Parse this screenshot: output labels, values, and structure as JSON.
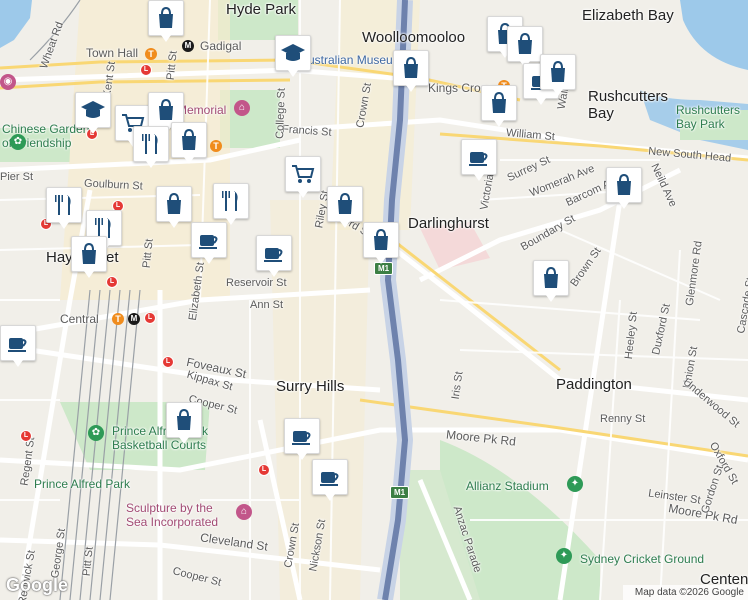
{
  "map": {
    "labels": {
      "hyde_park": "Hyde Park",
      "elizabeth_bay": "Elizabeth Bay",
      "woolloomooloo": "Woolloomooloo",
      "gadigal": "Gadigal",
      "town_hall": "Town Hall",
      "australian_museum": "Australian Museum",
      "kings_cross": "Kings Cross",
      "rushcutters_bay": "Rushcutters\nBay",
      "rushcutters_bay_park": "Rushcutters\nBay Park",
      "chinese_garden": "Chinese Garden\nof Friendship",
      "anzac_memorial": "Memorial",
      "william_st": "William St",
      "new_south_head": "New South Head",
      "darlinghurst": "Darlinghurst",
      "haymarket": "Haymarket",
      "central": "Central",
      "surry_hills": "Surry Hills",
      "paddington": "Paddington",
      "prince_alfred_park_courts": "Prince Alfred Park\nBasketball Courts",
      "prince_alfred_park": "Prince Alfred Park",
      "sculpture_by_the_sea": "Sculpture by the\nSea Incorporated",
      "allianz_stadium": "Allianz Stadium",
      "sydney_cricket_ground": "Sydney Cricket Ground",
      "moore_pk_rd": "Moore Pk Rd",
      "moore_pk_rd_2": "Moore Pk Rd",
      "cleveland_st": "Cleveland St",
      "anzac_parade": "Anzac Parade",
      "pier_st": "Pier St",
      "goulburn_st": "Goulburn St",
      "francis_st": "Francis St",
      "college_st": "College St",
      "crown_st": "Crown St",
      "crown_st_2": "Crown St",
      "riley_st": "Riley St",
      "oxford_st": "Oxford St",
      "oxford_st_2": "Oxford St",
      "reservoir_st": "Reservoir St",
      "ann_st": "Ann St",
      "foveaux_st": "Foveaux St",
      "kippax_st": "Kippax St",
      "cooper_st": "Cooper St",
      "cooper_st_2": "Cooper St",
      "elizabeth_st": "Elizabeth St",
      "pitt_st": "Pitt St",
      "pitt_st_2": "Pitt St",
      "pitt_st_3": "Pitt St",
      "regent_st": "Regent St",
      "george_st": "George St",
      "renwick_st": "Renwick St",
      "nickson_st": "Nickson St",
      "kent_st": "Kent St",
      "wheat_rd": "Wheat Rd",
      "victoria_st": "Victoria St",
      "surrey_st": "Surrey St",
      "womerah_ave": "Womerah Ave",
      "barcom_ave": "Barcom Ave",
      "boundary_st": "Boundary St",
      "brown_st": "Brown St",
      "neild_ave": "Neild Ave",
      "glenmore_rd": "Glenmore Rd",
      "cascade_st": "Cascade St",
      "heeley_st": "Heeley St",
      "duxford_st": "Duxford St",
      "union_st": "Union St",
      "underwood_st": "Underwood St",
      "iris_st": "Iris St",
      "renny_st": "Renny St",
      "leinster_st": "Leinster St",
      "gordon_st": "Gordon St",
      "centennial": "Centen",
      "walker_st": "Walk",
      "m1": "M1",
      "m1_2": "M1"
    },
    "attribution": {
      "data": "Map data ©2026 Google",
      "logo": "Google"
    },
    "pin_icons": [
      "shopping-bag-icon",
      "coffee-icon",
      "restaurant-icon",
      "cart-icon",
      "school-icon"
    ]
  }
}
